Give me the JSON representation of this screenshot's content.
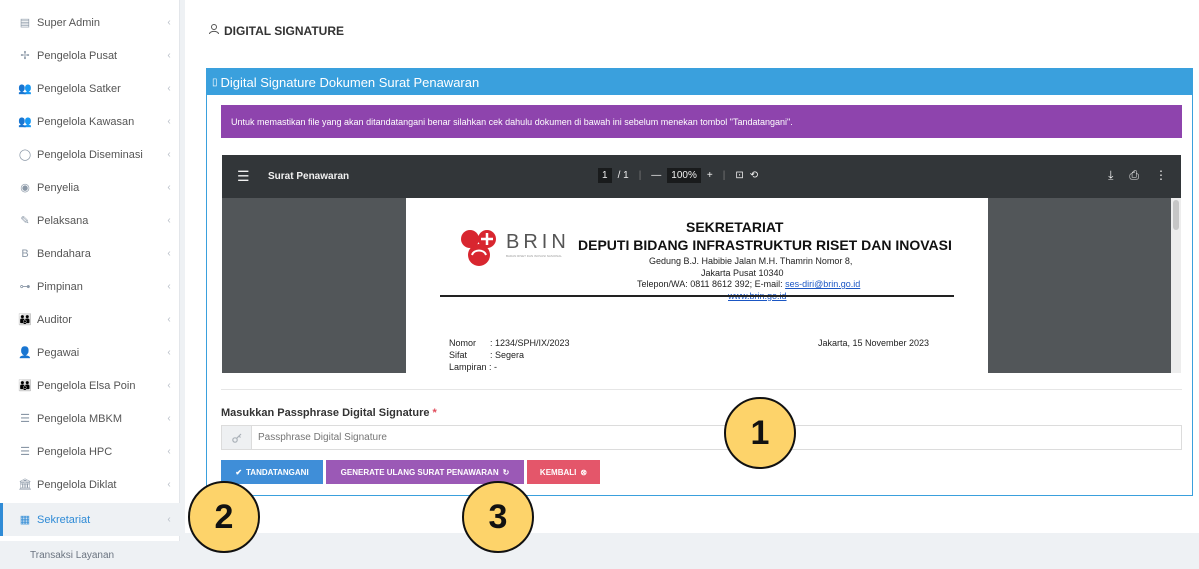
{
  "sidebar": {
    "items": [
      {
        "label": "Super Admin",
        "icon": "admin-icon",
        "glyph": "▤"
      },
      {
        "label": "Pengelola Pusat",
        "icon": "hub-icon",
        "glyph": "✢"
      },
      {
        "label": "Pengelola Satker",
        "icon": "users-icon",
        "glyph": "👥"
      },
      {
        "label": "Pengelola Kawasan",
        "icon": "users-icon",
        "glyph": "👥"
      },
      {
        "label": "Pengelola Diseminasi",
        "icon": "circle-icon",
        "glyph": "◯"
      },
      {
        "label": "Penyelia",
        "icon": "eye-icon",
        "glyph": "◉"
      },
      {
        "label": "Pelaksana",
        "icon": "wrench-icon",
        "glyph": "✎"
      },
      {
        "label": "Bendahara",
        "icon": "currency-icon",
        "glyph": "B"
      },
      {
        "label": "Pimpinan",
        "icon": "sitemap-icon",
        "glyph": "⊶"
      },
      {
        "label": "Auditor",
        "icon": "group-icon",
        "glyph": "👪"
      },
      {
        "label": "Pegawai",
        "icon": "user-icon",
        "glyph": "👤"
      },
      {
        "label": "Pengelola Elsa Poin",
        "icon": "group-icon",
        "glyph": "👪"
      },
      {
        "label": "Pengelola MBKM",
        "icon": "list-icon",
        "glyph": "☰"
      },
      {
        "label": "Pengelola HPC",
        "icon": "list-icon",
        "glyph": "☰"
      },
      {
        "label": "Pengelola Diklat",
        "icon": "bank-icon",
        "glyph": "🏛"
      },
      {
        "label": "Sekretariat",
        "icon": "building-icon",
        "glyph": "▦"
      }
    ],
    "sub_item": "Transaksi Layanan",
    "chevron": "‹"
  },
  "page": {
    "title": "DIGITAL SIGNATURE"
  },
  "panel": {
    "title": "Digital Signature Dokumen Surat Penawaran",
    "alert": "Untuk memastikan file yang akan ditandatangani benar silahkan cek dahulu dokumen di bawah ini sebelum menekan tombol \"Tandatangani\"."
  },
  "viewer": {
    "title": "Surat Penawaran",
    "page_current": "1",
    "page_total": "/ 1",
    "zoom": "100%",
    "zoom_out": "—",
    "zoom_in": "+",
    "menu_glyph": "☰",
    "fit_glyph": "⊡",
    "rotate_glyph": "⟲",
    "download_glyph": "⤓",
    "print_glyph": "⎙",
    "more_glyph": "⋮"
  },
  "document": {
    "logo_text": "BRIN",
    "logo_sub": "BADAN RISET DAN INOVASI NASIONAL",
    "header1": "SEKRETARIAT",
    "header2": "DEPUTI BIDANG INFRASTRUKTUR RISET DAN INOVASI",
    "address1": "Gedung B.J. Habibie Jalan M.H. Thamrin Nomor 8,",
    "address2": "Jakarta Pusat 10340",
    "contact_prefix": "Telepon/WA: 0811 8612 392; E-mail:",
    "email": "ses-diri@brin.go.id",
    "website": "www.brin.go.id",
    "nomor_label": "Nomor",
    "nomor_value": ": 1234/SPH/IX/2023",
    "sifat_label": "Sifat",
    "sifat_value": ": Segera",
    "lampiran_label": "Lampiran : -",
    "date": "Jakarta, 15 November 2023"
  },
  "form": {
    "label": "Masukkan Passphrase Digital Signature",
    "required_mark": "*",
    "placeholder": "Passphrase Digital Signature",
    "value": ""
  },
  "buttons": {
    "sign": "TANDATANGANI",
    "regenerate": "GENERATE ULANG SURAT PENAWARAN",
    "back": "KEMBALI"
  },
  "callouts": [
    "1",
    "2",
    "3"
  ],
  "colors": {
    "primary": "#3aa0dd",
    "alert": "#8e44ad",
    "sign_button": "#3f8ed8",
    "regen_button": "#9b59b6",
    "back_button": "#e4566a",
    "callout": "#fdd36a"
  }
}
